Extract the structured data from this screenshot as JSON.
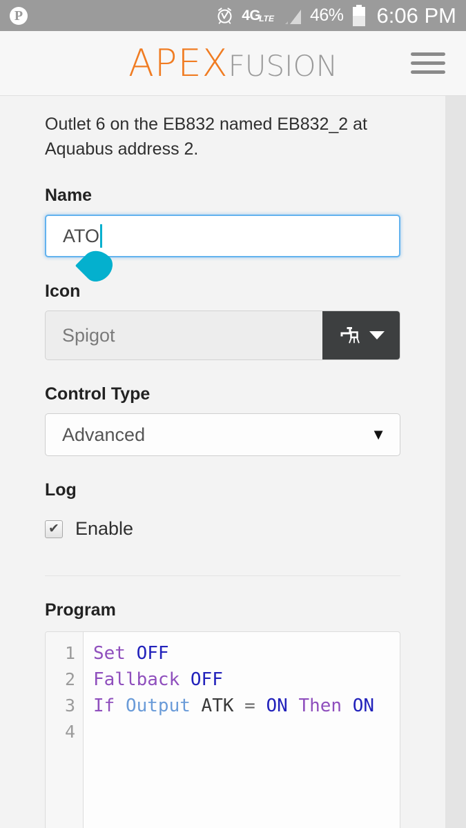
{
  "statusbar": {
    "app_icon": "pinterest-icon",
    "alarm_icon": "alarm-clock-icon",
    "network_main": "4G",
    "network_sub": "LTE",
    "signal_icon": "signal-bars-icon",
    "battery_percent": "46%",
    "battery_icon": "battery-icon",
    "time": "6:06 PM"
  },
  "appbar": {
    "logo_primary": "APEX",
    "logo_secondary": "FUSION",
    "menu_icon": "hamburger-menu-icon",
    "accent_color": "#f07c22",
    "secondary_color": "#9a9a9a"
  },
  "main": {
    "description": "Outlet 6 on the EB832 named EB832_2 at Aquabus address 2.",
    "name": {
      "label": "Name",
      "value": "ATO",
      "placeholder": "Name",
      "cursor_handle_color": "#04b0ce"
    },
    "icon": {
      "label": "Icon",
      "value": "Spigot",
      "button_icon": "spigot-faucet-icon",
      "caret_icon": "chevron-down-icon",
      "button_color": "#3d3f40"
    },
    "control_type": {
      "label": "Control Type",
      "value": "Advanced",
      "caret": "▼",
      "options": [
        "Advanced"
      ]
    },
    "log": {
      "label": "Log",
      "checkbox_label": "Enable",
      "checked": true,
      "tick": "✔"
    },
    "program": {
      "label": "Program",
      "line_numbers": [
        "1",
        "2",
        "3",
        "4"
      ],
      "lines": [
        [
          {
            "t": "Set",
            "c": "kw"
          },
          {
            "t": " ",
            "c": "op"
          },
          {
            "t": "OFF",
            "c": "val"
          }
        ],
        [
          {
            "t": "Fallback",
            "c": "kw"
          },
          {
            "t": " ",
            "c": "op"
          },
          {
            "t": "OFF",
            "c": "val"
          }
        ],
        [
          {
            "t": "If",
            "c": "kw"
          },
          {
            "t": " ",
            "c": "op"
          },
          {
            "t": "Output",
            "c": "fn"
          },
          {
            "t": " ",
            "c": "op"
          },
          {
            "t": "ATK",
            "c": "id"
          },
          {
            "t": " = ",
            "c": "op"
          },
          {
            "t": "ON",
            "c": "val"
          },
          {
            "t": " ",
            "c": "op"
          },
          {
            "t": "Then",
            "c": "kw"
          },
          {
            "t": " ",
            "c": "op"
          },
          {
            "t": "ON",
            "c": "val"
          }
        ],
        []
      ],
      "raw_text": "Set OFF\nFallback OFF\nIf Output ATK = ON Then ON\n"
    }
  }
}
